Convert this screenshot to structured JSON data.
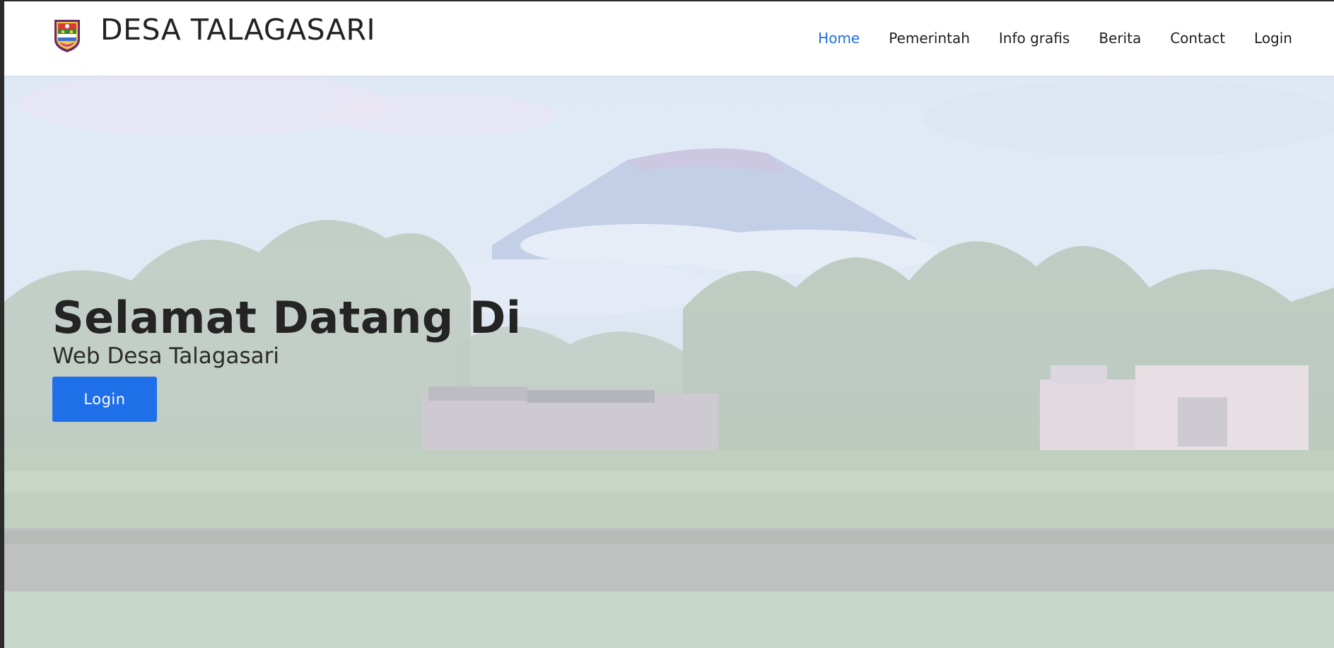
{
  "brand": {
    "name": "DESA TALAGASARI",
    "logo_icon": "village-emblem-icon"
  },
  "nav": {
    "items": [
      {
        "label": "Home",
        "active": true
      },
      {
        "label": "Pemerintah",
        "active": false
      },
      {
        "label": "Info grafis",
        "active": false
      },
      {
        "label": "Berita",
        "active": false
      },
      {
        "label": "Contact",
        "active": false
      },
      {
        "label": "Login",
        "active": false
      }
    ]
  },
  "hero": {
    "title": "Selamat Datang Di",
    "subtitle": "Web Desa Talagasari",
    "button_label": "Login"
  },
  "colors": {
    "accent": "#1f6fe8",
    "active_nav": "#1f6fdc",
    "text_dark": "#222222"
  }
}
